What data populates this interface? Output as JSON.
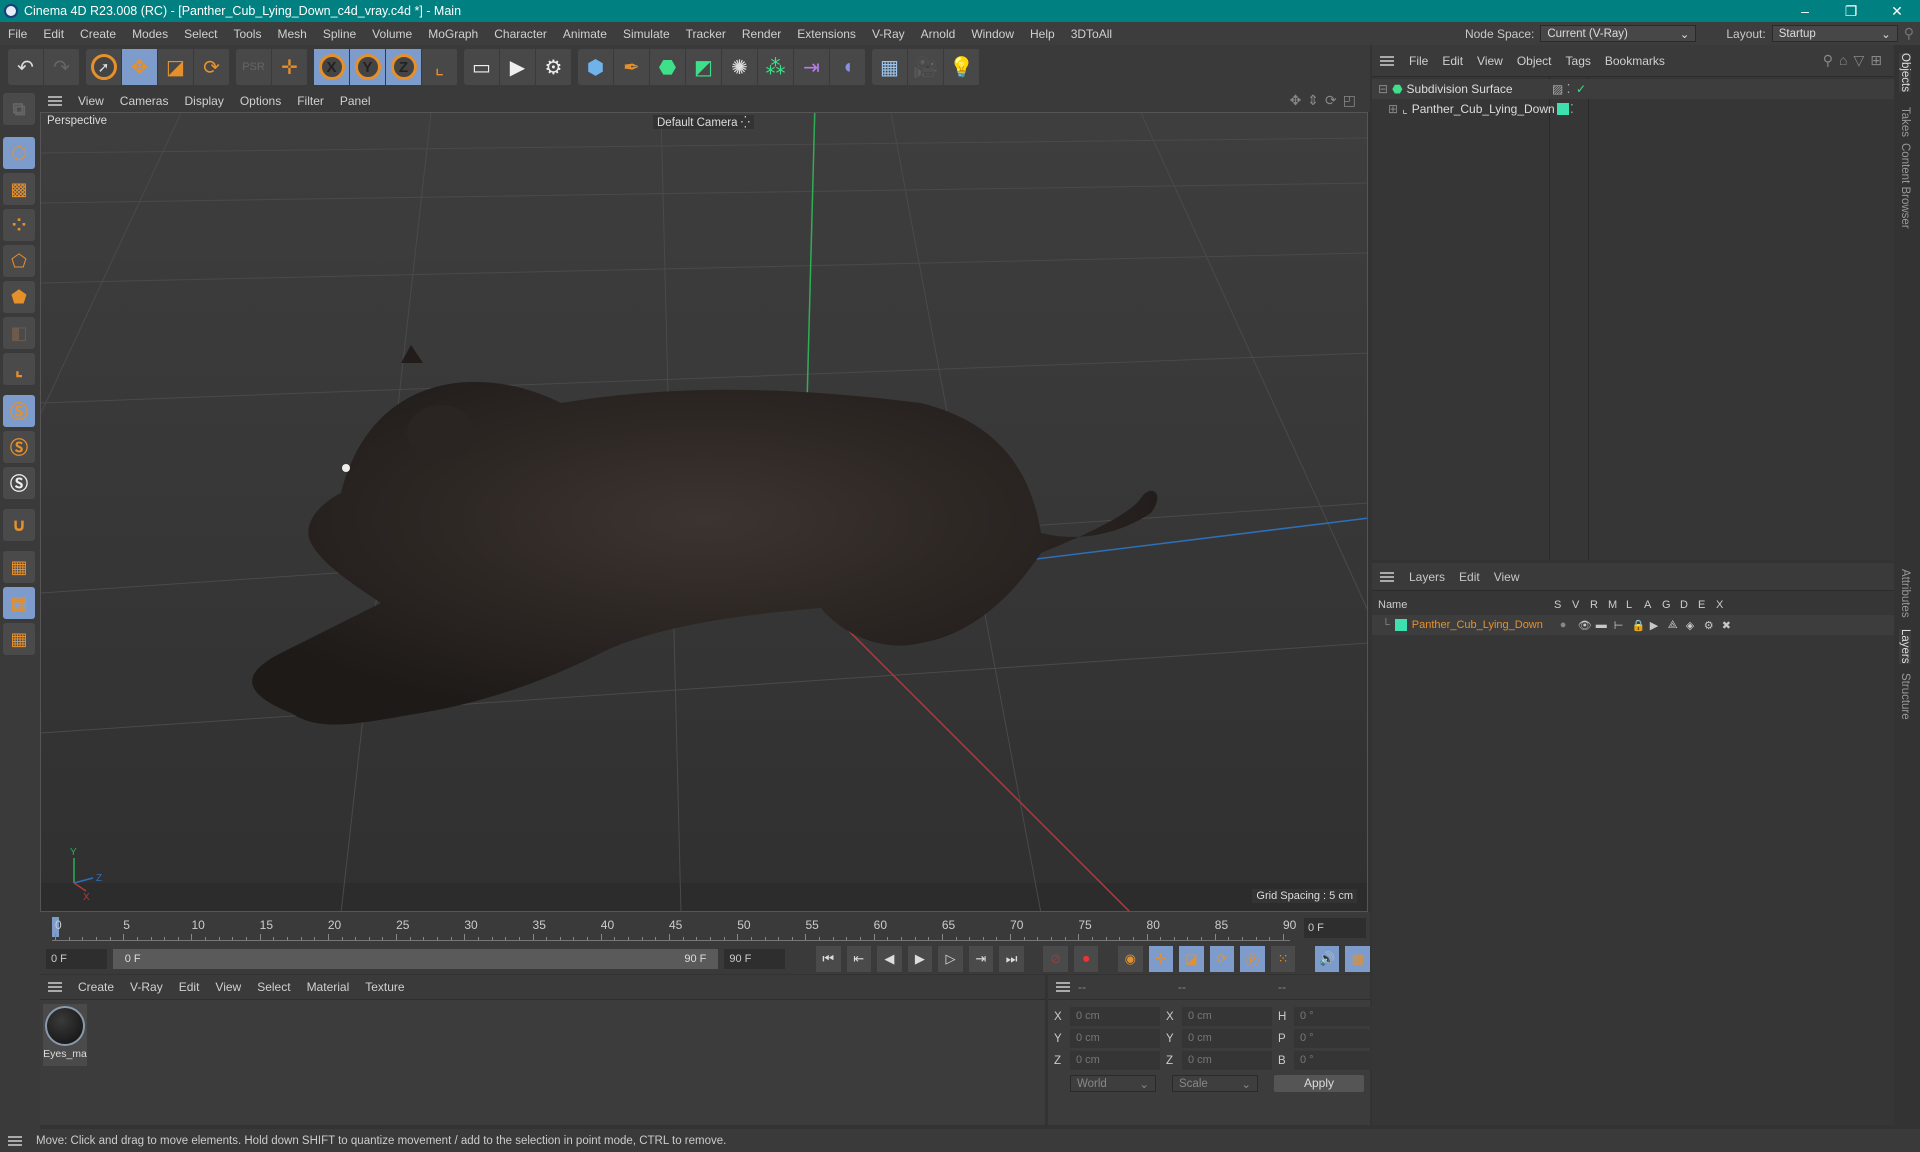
{
  "window": {
    "title": "Cinema 4D R23.008 (RC) - [Panther_Cub_Lying_Down_c4d_vray.c4d *] - Main",
    "controls": [
      "–",
      "❐",
      "✕"
    ]
  },
  "menubar": {
    "items": [
      "File",
      "Edit",
      "Create",
      "Modes",
      "Select",
      "Tools",
      "Mesh",
      "Spline",
      "Volume",
      "MoGraph",
      "Character",
      "Animate",
      "Simulate",
      "Tracker",
      "Render",
      "Extensions",
      "V-Ray",
      "Arnold",
      "Window",
      "Help",
      "3DToAll"
    ],
    "node_space_label": "Node Space:",
    "node_space_value": "Current (V-Ray)",
    "layout_label": "Layout:",
    "layout_value": "Startup"
  },
  "toolbar": {
    "undo": "undo-icon",
    "redo": "redo-icon",
    "tools": [
      "select",
      "move",
      "scale",
      "rotate",
      "psr",
      "transform"
    ],
    "axes": [
      "X",
      "Y",
      "Z"
    ],
    "coord_system": "world-coords-icon",
    "render": [
      "render-view",
      "render-picture",
      "render-settings"
    ],
    "objects": [
      "cube",
      "pen",
      "subdivision",
      "extrude",
      "array",
      "cloner",
      "symmetry",
      "deformer",
      "floor",
      "camera",
      "light"
    ]
  },
  "viewport": {
    "menu": [
      "View",
      "Cameras",
      "Display",
      "Options",
      "Filter",
      "Panel"
    ],
    "label": "Perspective",
    "camera": "Default Camera",
    "grid_spacing": "Grid Spacing : 5 cm",
    "axis_labels": {
      "x": "X",
      "y": "Y",
      "z": "Z"
    }
  },
  "timeline": {
    "ticks": [
      "0",
      "5",
      "10",
      "15",
      "20",
      "25",
      "30",
      "35",
      "40",
      "45",
      "50",
      "55",
      "60",
      "65",
      "70",
      "75",
      "80",
      "85",
      "90"
    ],
    "current_frame": "0 F",
    "start": "0 F",
    "range_start": "0 F",
    "range_end": "90 F",
    "end": "90 F"
  },
  "material_manager": {
    "menu": [
      "Create",
      "V-Ray",
      "Edit",
      "View",
      "Select",
      "Material",
      "Texture"
    ],
    "materials": [
      {
        "name": "Eyes_ma"
      }
    ]
  },
  "coordinates": {
    "headers": [
      "--",
      "--",
      "--"
    ],
    "rows": [
      {
        "l1": "X",
        "v1": "0 cm",
        "l2": "X",
        "v2": "0 cm",
        "l3": "H",
        "v3": "0 °"
      },
      {
        "l1": "Y",
        "v1": "0 cm",
        "l2": "Y",
        "v2": "0 cm",
        "l3": "P",
        "v3": "0 °"
      },
      {
        "l1": "Z",
        "v1": "0 cm",
        "l2": "Z",
        "v2": "0 cm",
        "l3": "B",
        "v3": "0 °"
      }
    ],
    "mode": "World",
    "type": "Scale",
    "apply": "Apply"
  },
  "object_manager": {
    "menu": [
      "File",
      "Edit",
      "View",
      "Object",
      "Tags",
      "Bookmarks"
    ],
    "objects": [
      {
        "name": "Subdivision Surface",
        "expanded": true
      },
      {
        "name": "Panther_Cub_Lying_Down",
        "expanded": false,
        "color": "#3fe0b0"
      }
    ]
  },
  "layer_manager": {
    "menu": [
      "Layers",
      "Edit",
      "View"
    ],
    "columns": [
      "Name",
      "S",
      "V",
      "R",
      "M",
      "L",
      "A",
      "G",
      "D",
      "E",
      "X"
    ],
    "layers": [
      {
        "name": "Panther_Cub_Lying_Down",
        "color": "#3fe0b0"
      }
    ]
  },
  "side_tabs": {
    "top": [
      "Objects",
      "Takes",
      "Content Browser"
    ],
    "bottom": [
      "Attributes",
      "Layers",
      "Structure"
    ]
  },
  "status": "Move: Click and drag to move elements. Hold down SHIFT to quantize movement / add to the selection in point mode, CTRL to remove.",
  "colors": {
    "title_bar": "#008080",
    "accent_orange": "#e6902c",
    "active_blue": "#7e9ccb",
    "layer_green": "#3fe0b0",
    "layer_name_orange": "#e6902c"
  }
}
